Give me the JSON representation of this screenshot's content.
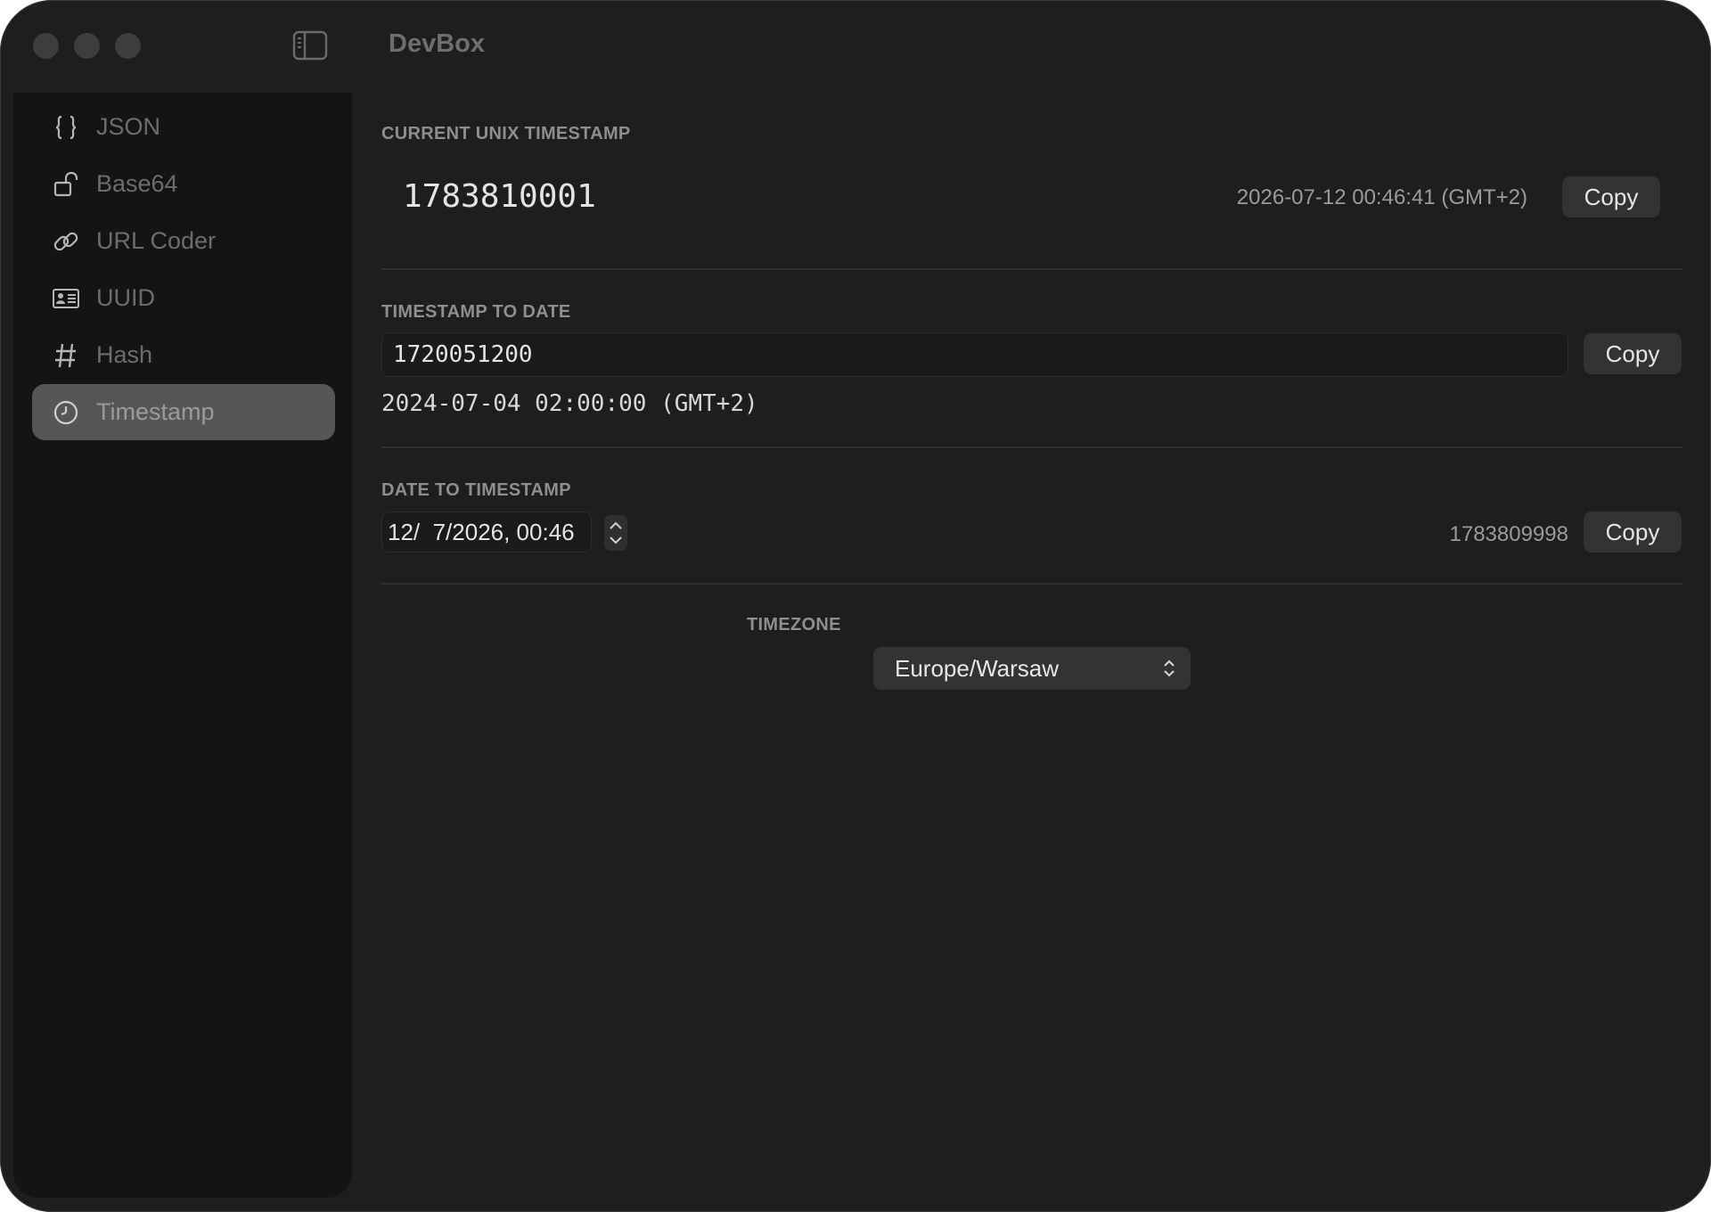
{
  "window": {
    "title": "DevBox"
  },
  "sidebar": {
    "items": [
      {
        "label": "JSON",
        "icon": "braces-icon"
      },
      {
        "label": "Base64",
        "icon": "lock-open-icon"
      },
      {
        "label": "URL Coder",
        "icon": "link-icon"
      },
      {
        "label": "UUID",
        "icon": "id-card-icon"
      },
      {
        "label": "Hash",
        "icon": "hash-icon"
      },
      {
        "label": "Timestamp",
        "icon": "clock-icon",
        "active": true
      }
    ]
  },
  "current": {
    "title": "CURRENT UNIX TIMESTAMP",
    "value": "1783810001",
    "date": "2026-07-12 00:46:41 (GMT+2)",
    "copy_label": "Copy"
  },
  "timestamp_to_date": {
    "title": "TIMESTAMP TO DATE",
    "input_value": "1720051200",
    "result": "2024-07-04 02:00:00 (GMT+2)",
    "copy_label": "Copy"
  },
  "date_to_timestamp": {
    "title": "DATE TO TIMESTAMP",
    "input_value": "12/  7/2026, 00:46",
    "result": "1783809998",
    "copy_label": "Copy"
  },
  "timezone": {
    "label": "TIMEZONE",
    "selected": "Europe/Warsaw"
  },
  "colors": {
    "window_bg": "#1e1e1e",
    "sidebar_bg": "#141414",
    "active_item_bg": "#565656",
    "button_bg": "#333333"
  }
}
